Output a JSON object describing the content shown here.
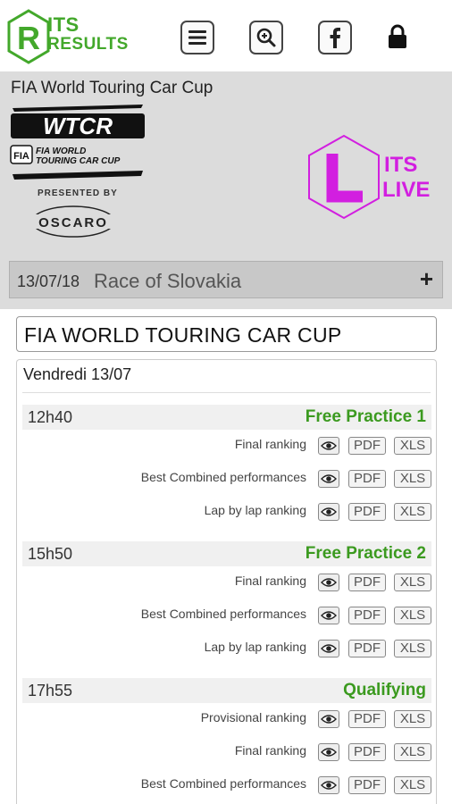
{
  "app": {
    "logo_line1": "ITS",
    "logo_line2": "RESULTS",
    "menu_icon": "hamburger-icon",
    "search_icon": "zoom-search-icon",
    "facebook_icon": "facebook-icon",
    "lock_icon": "lock-icon"
  },
  "header": {
    "series_title": "FIA World Touring Car Cup",
    "wtcr_logo_text": "WTCR",
    "fia_text": "FIA",
    "wtcr_sub1": "FIA WORLD",
    "wtcr_sub2": "TOURING CAR CUP",
    "presented_by": "PRESENTED BY",
    "sponsor": "OSCARO",
    "live_logo_line1": "ITS",
    "live_logo_line2": "LIVE",
    "event_date": "13/07/18",
    "event_name": "Race of Slovakia",
    "expand_symbol": "+"
  },
  "content": {
    "cup_title": "FIA WORLD TOURING CAR CUP",
    "day_label": "Vendredi 13/07",
    "sessions": [
      {
        "time": "12h40",
        "name": "Free Practice 1",
        "docs": [
          {
            "label": "Final ranking",
            "pdf": "PDF",
            "xls": "XLS"
          },
          {
            "label": "Best Combined performances",
            "pdf": "PDF",
            "xls": "XLS"
          },
          {
            "label": "Lap by lap ranking",
            "pdf": "PDF",
            "xls": "XLS"
          }
        ]
      },
      {
        "time": "15h50",
        "name": "Free Practice 2",
        "docs": [
          {
            "label": "Final ranking",
            "pdf": "PDF",
            "xls": "XLS"
          },
          {
            "label": "Best Combined performances",
            "pdf": "PDF",
            "xls": "XLS"
          },
          {
            "label": "Lap by lap ranking",
            "pdf": "PDF",
            "xls": "XLS"
          }
        ]
      },
      {
        "time": "17h55",
        "name": "Qualifying",
        "docs": [
          {
            "label": "Provisional ranking",
            "pdf": "PDF",
            "xls": "XLS"
          },
          {
            "label": "Final ranking",
            "pdf": "PDF",
            "xls": "XLS"
          },
          {
            "label": "Best Combined performances",
            "pdf": "PDF",
            "xls": "XLS"
          }
        ]
      }
    ]
  },
  "colors": {
    "brand_green": "#43a82b",
    "session_green": "#3b9a1f",
    "live_magenta": "#d21fe0",
    "header_grey": "#dcdcdc"
  }
}
